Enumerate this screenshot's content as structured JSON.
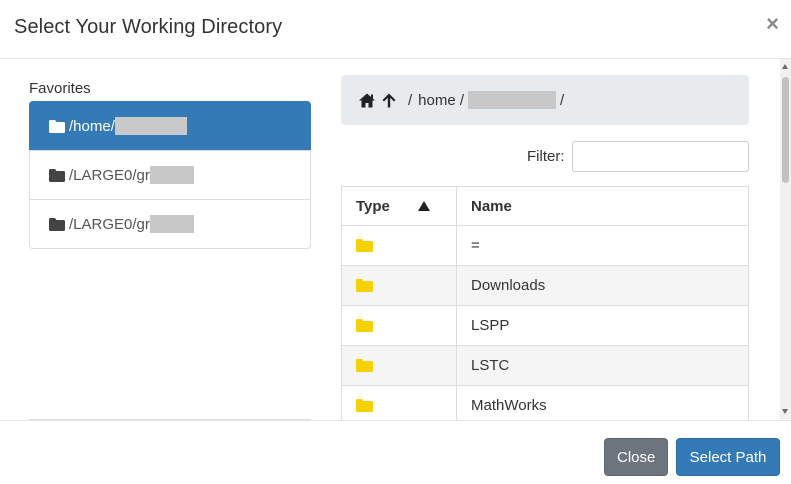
{
  "dialog": {
    "title": "Select Your Working Directory",
    "close_symbol": "×"
  },
  "favorites": {
    "label": "Favorites",
    "items": [
      {
        "path": "/home/",
        "active": true,
        "icon": "folder-icon"
      },
      {
        "path": "/LARGE0/gr",
        "active": false,
        "icon": "folder-icon"
      },
      {
        "path": "/LARGE0/gr",
        "active": false,
        "icon": "folder-icon"
      }
    ]
  },
  "breadcrumb": {
    "home_icon": "home-icon",
    "up_icon": "arrow-up-icon",
    "sep1": "/",
    "segment1": "home /",
    "sep2": "/"
  },
  "filter": {
    "label": "Filter:",
    "value": "",
    "placeholder": ""
  },
  "table": {
    "columns": [
      "Type",
      "Name"
    ],
    "sort_column": "Type",
    "sort_direction": "ascending",
    "rows": [
      {
        "type_icon": "folder-icon",
        "name": "="
      },
      {
        "type_icon": "folder-icon",
        "name": "Downloads"
      },
      {
        "type_icon": "folder-icon",
        "name": "LSPP"
      },
      {
        "type_icon": "folder-icon",
        "name": "LSTC"
      },
      {
        "type_icon": "folder-icon",
        "name": "MathWorks"
      }
    ]
  },
  "footer": {
    "close_label": "Close",
    "select_label": "Select Path"
  },
  "colors": {
    "primary": "#337ab7",
    "secondary": "#6c757d",
    "folder_yellow": "#f5d100",
    "breadcrumb_bg": "#e8ebee"
  }
}
